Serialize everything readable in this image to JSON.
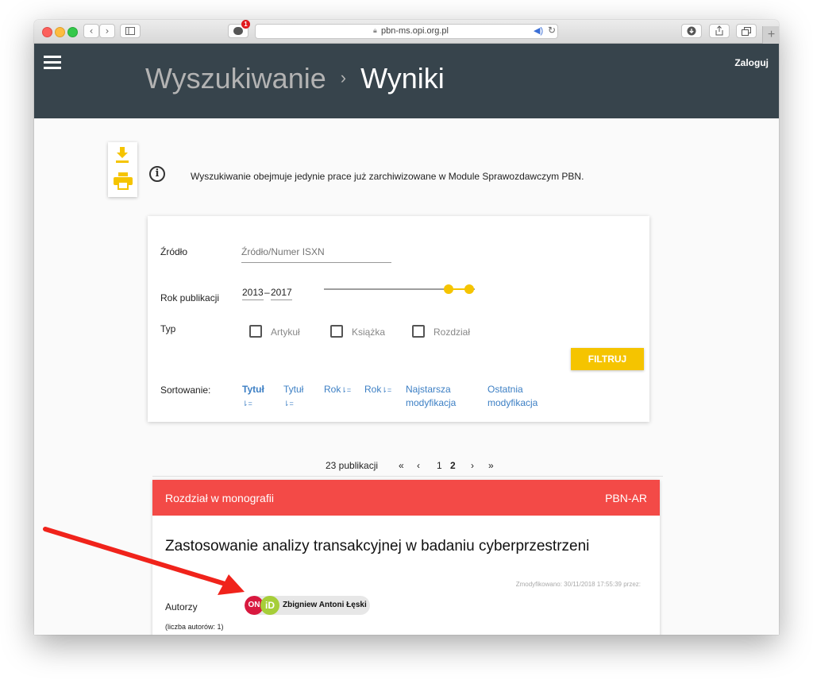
{
  "browser": {
    "url": "pbn-ms.opi.org.pl",
    "badge_count": "1"
  },
  "header": {
    "breadcrumb_parent": "Wyszukiwanie",
    "breadcrumb_separator": "›",
    "breadcrumb_current": "Wyniki",
    "login_label": "Zaloguj"
  },
  "info": {
    "text": "Wyszukiwanie obejmuje jedynie prace już zarchiwizowane w Module Sprawozdawczym PBN."
  },
  "filter": {
    "source_label": "Źródło",
    "source_placeholder": "Źródło/Numer ISXN",
    "year_label": "Rok publikacji",
    "year_from": "2013",
    "year_dash": "–",
    "year_to": "2017",
    "type_label": "Typ",
    "types": [
      "Artykuł",
      "Książka",
      "Rozdział"
    ],
    "filter_button": "FILTRUJ",
    "sort_label": "Sortowanie:",
    "sort_options": [
      {
        "label": "Tytuł",
        "glyph": "⇂="
      },
      {
        "label": "Tytuł",
        "glyph": "⇂="
      },
      {
        "label": "Rok",
        "glyph": "⇂="
      },
      {
        "label": "Rok",
        "glyph": "⇂="
      },
      {
        "label": "Najstarsza modyfikacja"
      },
      {
        "label": "Ostatnia modyfikacja"
      }
    ]
  },
  "pagination": {
    "count_label": "23 publikacji",
    "first": "«",
    "prev": "‹",
    "pages": [
      "1",
      "2"
    ],
    "next": "›",
    "last": "»"
  },
  "result": {
    "type_label": "Rozdział w monografii",
    "source_tag": "PBN-AR",
    "title": "Zastosowanie analizy transakcyjnej w badaniu cyberprzestrzeni",
    "modified": "Zmodyfikowano: 30/11/2018 17:55:39 przez:",
    "authors_label": "Autorzy",
    "authors_count": "(liczba autorów: 1)",
    "author_name": "Zbigniew Antoni Łęski",
    "badge_on": "ON",
    "badge_id": "iD"
  },
  "colors": {
    "header_bg": "#37444c",
    "accent_yellow": "#f5c400",
    "result_header": "#f34a47",
    "link_blue": "#3c7fc4"
  }
}
